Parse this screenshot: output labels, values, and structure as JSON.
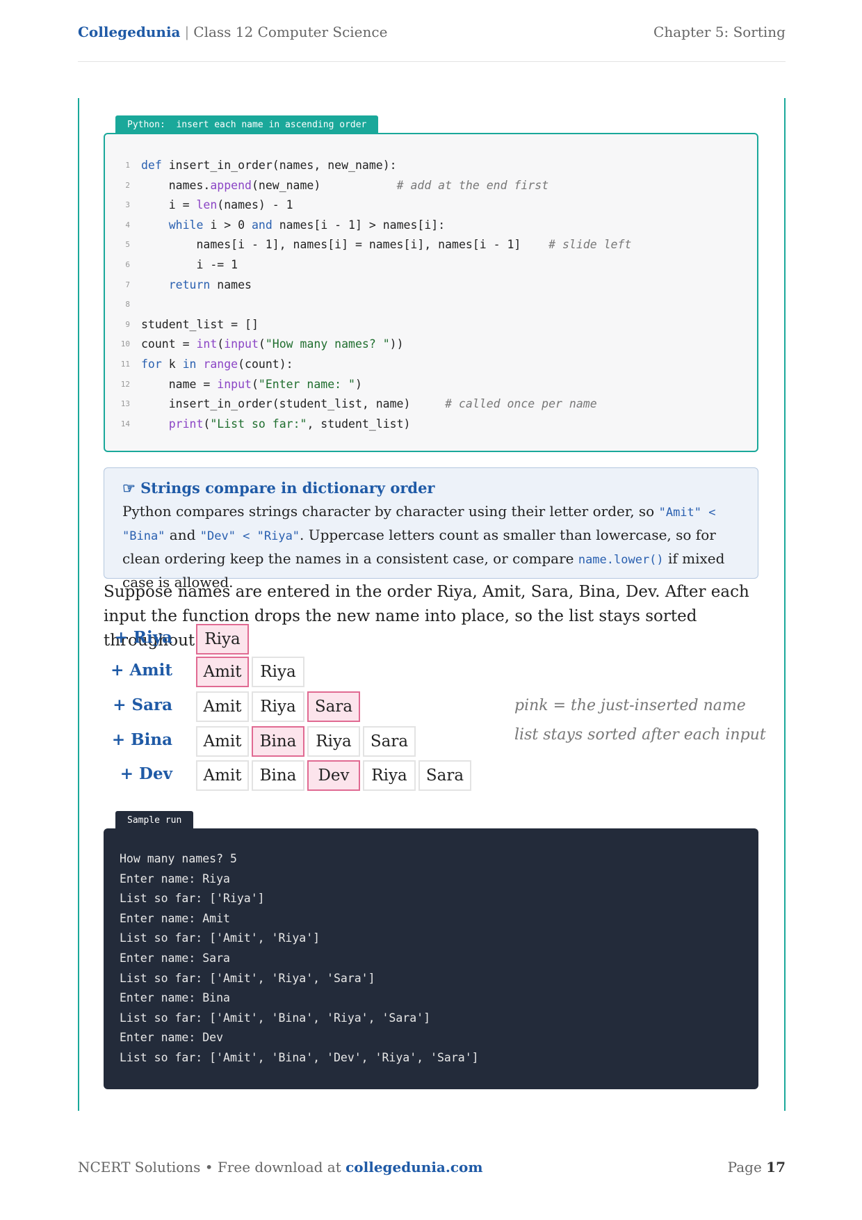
{
  "header": {
    "brand": "Collegedunia",
    "separator": "|",
    "subject": "Class 12 Computer Science",
    "chapter": "Chapter 5: Sorting"
  },
  "code_block": {
    "tab_label": "Python:  insert each name in ascending order",
    "lines": [
      {
        "n": "1"
      },
      {
        "n": "2"
      },
      {
        "n": "3"
      },
      {
        "n": "4"
      },
      {
        "n": "5"
      },
      {
        "n": "6"
      },
      {
        "n": "7"
      },
      {
        "n": "8"
      },
      {
        "n": "9"
      },
      {
        "n": "10"
      },
      {
        "n": "11"
      },
      {
        "n": "12"
      },
      {
        "n": "13"
      },
      {
        "n": "14"
      }
    ],
    "code": [
      "def insert_in_order(names, new_name):",
      "    names.append(new_name)           # add at the end first",
      "    i = len(names) - 1",
      "    while i > 0 and names[i - 1] > names[i]:",
      "        names[i - 1], names[i] = names[i], names[i - 1]    # slide left",
      "        i -= 1",
      "    return names",
      "",
      "student_list = []",
      "count = int(input(\"How many names? \"))",
      "for k in range(count):",
      "    name = input(\"Enter name: \")",
      "    insert_in_order(student_list, name)     # called once per name",
      "    print(\"List so far:\", student_list)"
    ]
  },
  "note": {
    "icon": "☞",
    "title": "Strings compare in dictionary order",
    "t1": "Python compares strings character by character using their letter order, so ",
    "c1": "\"Amit\" < \"Bina\"",
    "t2": " and ",
    "c2": "\"Dev\" < \"Riya\"",
    "t3": ". Uppercase letters count as smaller than lowercase, so for clean ordering keep the names in a consistent case, or compare ",
    "c3": "name.lower()",
    "t4": " if mixed case is allowed."
  },
  "paragraph": "Suppose names are entered in the order Riya, Amit, Sara, Bina, Dev. After each input the function drops the new name into place, so the list stays sorted throughout.",
  "diagram": {
    "rows": [
      {
        "label": "+ Riya",
        "cells": [
          "Riya"
        ],
        "new_index": 0
      },
      {
        "label": "+ Amit",
        "cells": [
          "Amit",
          "Riya"
        ],
        "new_index": 0
      },
      {
        "label": "+ Sara",
        "cells": [
          "Amit",
          "Riya",
          "Sara"
        ],
        "new_index": 2
      },
      {
        "label": "+ Bina",
        "cells": [
          "Amit",
          "Bina",
          "Riya",
          "Sara"
        ],
        "new_index": 1
      },
      {
        "label": "+ Dev",
        "cells": [
          "Amit",
          "Bina",
          "Dev",
          "Riya",
          "Sara"
        ],
        "new_index": 2
      }
    ],
    "legend": [
      "pink = the just-inserted name",
      "list stays sorted after each input"
    ],
    "colors": {
      "new_fill": "#fce4ec",
      "new_border": "#e06a92"
    }
  },
  "sample_run": {
    "tab_label": "Sample run",
    "lines": [
      "How many names? 5",
      "Enter name: Riya",
      "List so far: ['Riya']",
      "Enter name: Amit",
      "List so far: ['Amit', 'Riya']",
      "Enter name: Sara",
      "List so far: ['Amit', 'Riya', 'Sara']",
      "Enter name: Bina",
      "List so far: ['Amit', 'Bina', 'Riya', 'Sara']",
      "Enter name: Dev",
      "List so far: ['Amit', 'Bina', 'Dev', 'Riya', 'Sara']"
    ]
  },
  "footer": {
    "left_text": "NCERT Solutions • Free download at ",
    "link": "collegedunia.com",
    "page_label": "Page ",
    "page_number": "17"
  },
  "colors": {
    "accent": "#1aa89a",
    "brand": "#1f5aa6",
    "dark_block": "#232b3a"
  }
}
